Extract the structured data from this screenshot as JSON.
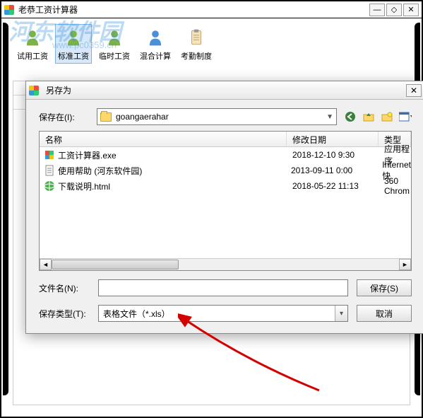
{
  "app": {
    "title": "老恭工资计算器"
  },
  "watermark": {
    "text": "河东软件园",
    "url": "www.pc0359.cn"
  },
  "toolbar": {
    "items": [
      {
        "label": "试用工资",
        "icon": "person-green"
      },
      {
        "label": "标准工资",
        "icon": "person-green",
        "selected": true
      },
      {
        "label": "临时工资",
        "icon": "person-green"
      },
      {
        "label": "混合计算",
        "icon": "person-blue"
      },
      {
        "label": "考勤制度",
        "icon": "clipboard"
      }
    ]
  },
  "save_dialog": {
    "title": "另存为",
    "location_label": "保存在(I):",
    "current_folder": "goangaerahar",
    "columns": {
      "name": "名称",
      "date": "修改日期",
      "type": "类型"
    },
    "files": [
      {
        "name": "工资计算器.exe",
        "date": "2018-12-10 9:30",
        "type": "应用程序",
        "icon": "app"
      },
      {
        "name": "使用帮助 (河东软件园)",
        "date": "2013-09-11 0:00",
        "type": "Internet 快",
        "icon": "doc"
      },
      {
        "name": "下载说明.html",
        "date": "2018-05-22 11:13",
        "type": "360 Chrom",
        "icon": "html"
      }
    ],
    "filename_label": "文件名(N):",
    "filename_value": "",
    "filetype_label": "保存类型(T):",
    "filetype_value": "表格文件（*.xls）",
    "save_btn": "保存(S)",
    "cancel_btn": "取消"
  }
}
